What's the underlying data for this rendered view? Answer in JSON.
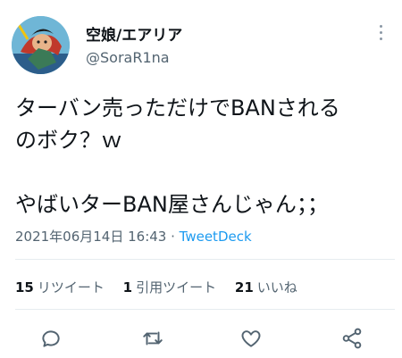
{
  "user": {
    "display_name": "空娘/エアリア",
    "handle": "@SoraR1na",
    "avatar_icon": "anime-character-avatar"
  },
  "tweet": {
    "lines": [
      "ターバン売っただけでBANされる",
      "のボク？ｗ",
      "やばいターBAN屋さんじゃん；；"
    ],
    "timestamp": "2021年06月14日 16:43",
    "separator": " · ",
    "source": "TweetDeck"
  },
  "stats": {
    "retweets_count": "15",
    "retweets_label": "リツイート",
    "quotes_count": "1",
    "quotes_label": "引用ツイート",
    "likes_count": "21",
    "likes_label": "いいね"
  },
  "icons": {
    "more": "more-vertical-icon",
    "reply": "reply-icon",
    "retweet": "retweet-icon",
    "like": "heart-icon",
    "share": "share-icon"
  },
  "colors": {
    "text": "#0f1419",
    "secondary": "#536471",
    "link": "#1d9bf0",
    "divider": "#e6ecf0"
  }
}
